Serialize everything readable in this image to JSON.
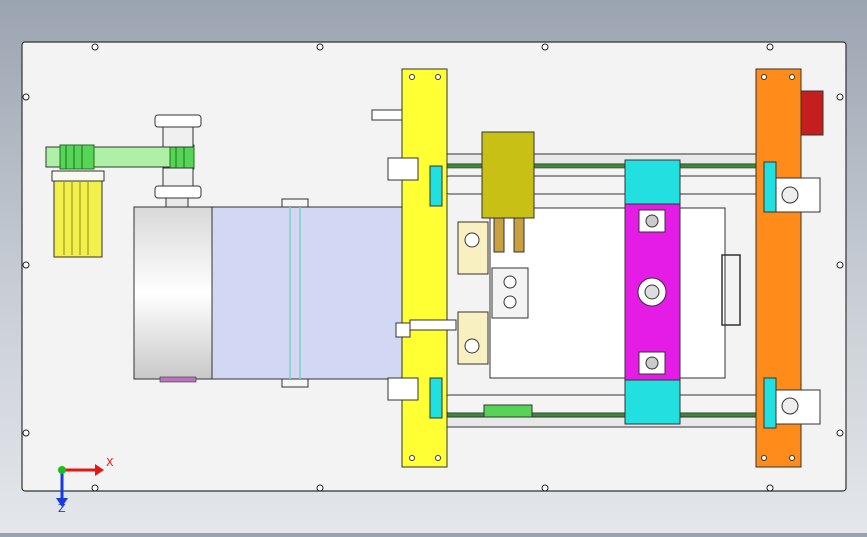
{
  "view": {
    "background_top": "#9aa4b0",
    "background_bottom": "#e4e7eb",
    "plate_color": "#f3f3f3"
  },
  "colors": {
    "yellow_plate": "#ffff33",
    "orange_plate": "#ff8c1a",
    "magenta_slider": "#e51ce5",
    "cyan_block": "#22e0e0",
    "olive_block": "#c8c014",
    "green_belt": "#aef0a6",
    "lavender_film": "#d2d8f4",
    "red_bracket": "#c41e1e"
  },
  "triad": {
    "x_label": "X",
    "z_label": "Z",
    "x_color": "#e01818",
    "y_color": "#18c018",
    "z_color": "#1838e0"
  }
}
